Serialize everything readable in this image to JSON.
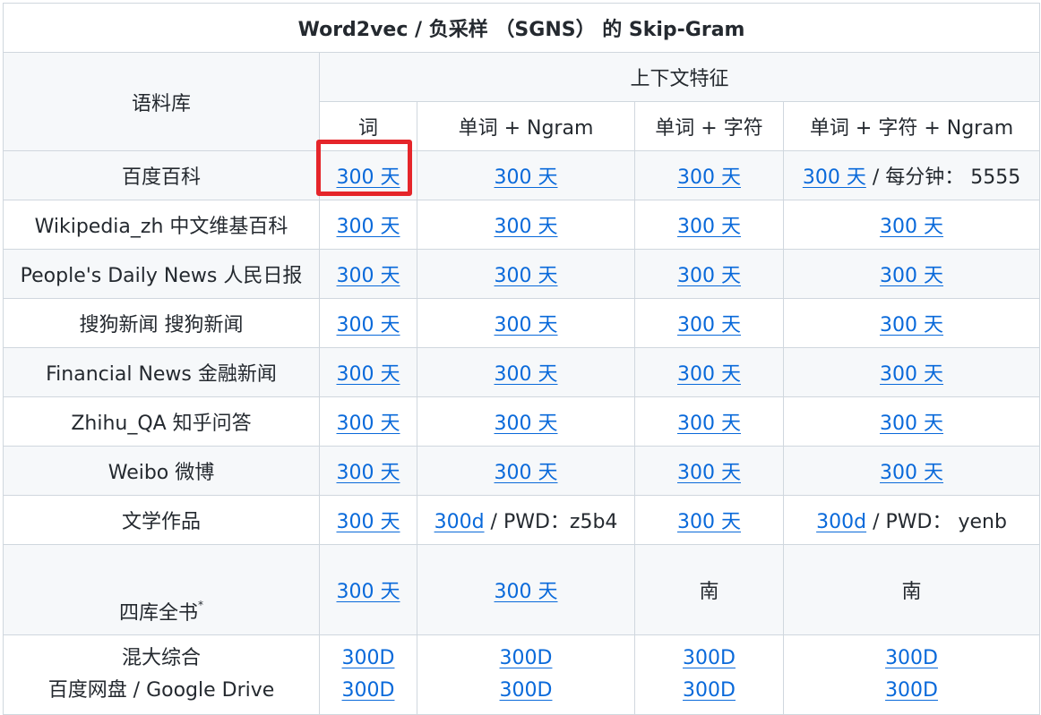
{
  "table": {
    "title": "Word2vec / 负采样 （SGNS） 的 Skip-Gram",
    "corpus_header": "语料库",
    "context_header": "上下文特征",
    "columns": [
      "词",
      "单词 + Ngram",
      "单词 + 字符",
      "单词 + 字符 + Ngram"
    ],
    "link_label": "300 天",
    "rows": [
      {
        "corpus": "百度百科",
        "extra": " / 每分钟：  5555"
      },
      {
        "corpus": "Wikipedia_zh 中文维基百科"
      },
      {
        "corpus": "People's Daily News 人民日报"
      },
      {
        "corpus": "搜狗新闻 搜狗新闻"
      },
      {
        "corpus": "Financial News 金融新闻"
      },
      {
        "corpus": "Zhihu_QA 知乎问答"
      },
      {
        "corpus": "Weibo 微博"
      },
      {
        "corpus": "文学作品",
        "cell2_link": "300d",
        "cell2_rest": " / PWD：z5b4",
        "cell4_link": "300d",
        "cell4_rest": " / PWD：  yenb"
      },
      {
        "corpus": "四库全书",
        "corpus_sup": "*",
        "na_text": "南"
      },
      {
        "corpus_line1": "混大综合",
        "corpus_line2": "百度网盘 / Google Drive",
        "link_label": "300D"
      }
    ]
  },
  "colors": {
    "link": "#0969da",
    "highlight_border": "#e5252a",
    "row_alt_bg": "#f6f8fa",
    "grid_border": "#d0d7de"
  }
}
